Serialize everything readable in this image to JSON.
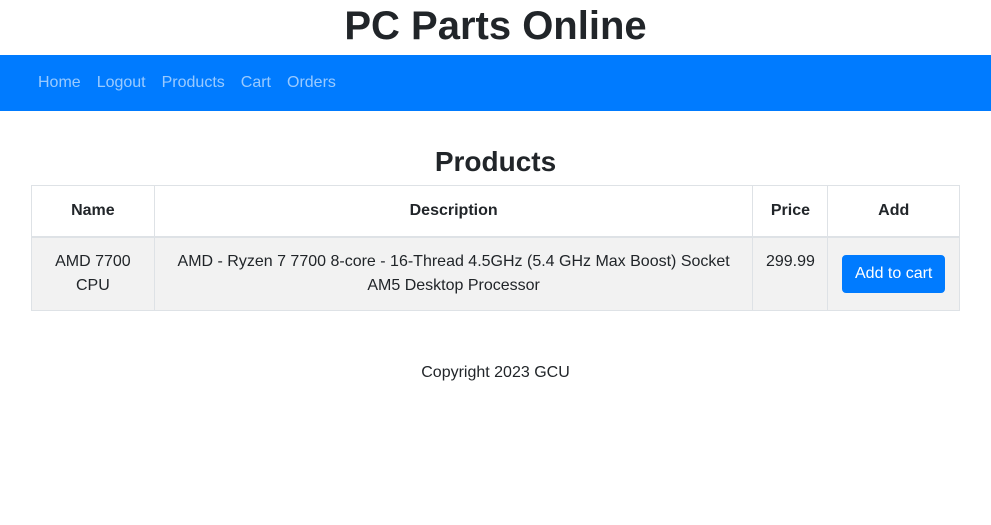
{
  "site": {
    "title": "PC Parts Online"
  },
  "nav": {
    "items": [
      {
        "label": "Home"
      },
      {
        "label": "Logout"
      },
      {
        "label": "Products"
      },
      {
        "label": "Cart"
      },
      {
        "label": "Orders"
      }
    ],
    "background_color": "#007bff"
  },
  "page": {
    "heading": "Products"
  },
  "table": {
    "headers": [
      "Name",
      "Description",
      "Price",
      "Add"
    ],
    "rows": [
      {
        "name": "AMD 7700 CPU",
        "description": "AMD - Ryzen 7 7700 8-core - 16-Thread 4.5GHz (5.4 GHz Max Boost) Socket AM5 Desktop Processor",
        "price": "299.99",
        "action_label": "Add to cart"
      }
    ]
  },
  "footer": {
    "text": "Copyright 2023 GCU"
  },
  "colors": {
    "accent": "#007bff",
    "row_background": "#f2f2f2"
  }
}
